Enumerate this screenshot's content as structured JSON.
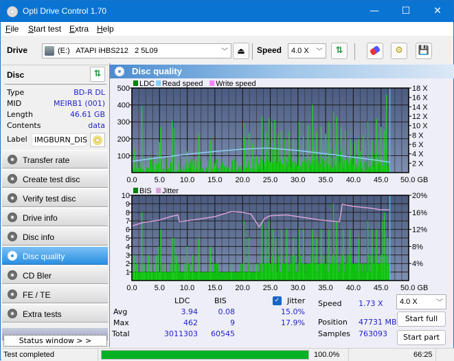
{
  "window": {
    "title": "Opti Drive Control 1.70",
    "minimize": "—",
    "maximize": "☐",
    "close": "✕"
  },
  "menu": {
    "items": [
      {
        "label": "File",
        "accel": "F",
        "rest": "ile"
      },
      {
        "label": "Start test",
        "accel": "S",
        "rest": "tart test"
      },
      {
        "label": "Extra",
        "accel": "E",
        "rest": "xtra"
      },
      {
        "label": "Help",
        "accel": "H",
        "rest": "elp"
      }
    ]
  },
  "toolbar": {
    "drive_label": "Drive",
    "drive_value": "(E:)   ATAPI iHBS212   2 5L09",
    "speed_label": "Speed",
    "speed_value": "4.0 X",
    "icons": [
      "drive-icon",
      "eject-icon",
      "refresh-icon",
      "erase-icon",
      "settings-icon",
      "save-icon"
    ]
  },
  "disc": {
    "header": "Disc",
    "rows": [
      {
        "label": "Type",
        "value": "BD-R DL"
      },
      {
        "label": "MID",
        "value": "MEIRB1 (001)"
      },
      {
        "label": "Length",
        "value": "46.61 GB"
      },
      {
        "label": "Contents",
        "value": "data"
      }
    ],
    "label_label": "Label",
    "label_value": "IMGBURN_DIS"
  },
  "nav": {
    "items": [
      {
        "label": "Transfer rate",
        "active": false
      },
      {
        "label": "Create test disc",
        "active": false
      },
      {
        "label": "Verify test disc",
        "active": false
      },
      {
        "label": "Drive info",
        "active": false
      },
      {
        "label": "Disc info",
        "active": false
      },
      {
        "label": "Disc quality",
        "active": true
      },
      {
        "label": "CD Bler",
        "active": false
      },
      {
        "label": "FE / TE",
        "active": false
      },
      {
        "label": "Extra tests",
        "active": false
      }
    ],
    "status_window": "Status window > >"
  },
  "panel": {
    "title": "Disc quality"
  },
  "chart_data": [
    {
      "type": "bar",
      "title": "",
      "legend": [
        "LDC",
        "Read speed",
        "Write speed"
      ],
      "legend_colors": {
        "LDC": "#008000",
        "Read speed": "#7fcfff",
        "Write speed": "#ff80ff"
      },
      "legend_placement": "top-left",
      "xlabel": "GB",
      "x_ticks": [
        "0.0",
        "5.0",
        "10.0",
        "15.0",
        "20.0",
        "25.0",
        "30.0",
        "35.0",
        "40.0",
        "45.0",
        "50.0 GB"
      ],
      "xlim": [
        0,
        50
      ],
      "y_ticks_left": [
        "500",
        "400",
        "300",
        "200",
        "100"
      ],
      "ylim_left": [
        0,
        500
      ],
      "y_ticks_right": [
        "18 X",
        "16 X",
        "14 X",
        "12 X",
        "10 X",
        "8 X",
        "6 X",
        "4 X",
        "2 X"
      ],
      "ylim_right": [
        0,
        18
      ],
      "end_marker_gb": 46.61,
      "ldc_peaks": [
        {
          "x": 0.5,
          "y": 140
        },
        {
          "x": 1.2,
          "y": 30
        },
        {
          "x": 1.8,
          "y": 395
        },
        {
          "x": 2.5,
          "y": 40
        },
        {
          "x": 3.2,
          "y": 95
        },
        {
          "x": 4.0,
          "y": 60
        },
        {
          "x": 4.6,
          "y": 120
        },
        {
          "x": 5.2,
          "y": 270
        },
        {
          "x": 5.0,
          "y": 180
        },
        {
          "x": 6.0,
          "y": 30
        },
        {
          "x": 7.3,
          "y": 305
        },
        {
          "x": 7.6,
          "y": 265
        },
        {
          "x": 8.5,
          "y": 60
        },
        {
          "x": 10.0,
          "y": 125
        },
        {
          "x": 11.0,
          "y": 50
        },
        {
          "x": 12.1,
          "y": 235
        },
        {
          "x": 14.2,
          "y": 190
        },
        {
          "x": 15.0,
          "y": 40
        },
        {
          "x": 17.0,
          "y": 30
        },
        {
          "x": 18.5,
          "y": 35
        },
        {
          "x": 20.2,
          "y": 295
        },
        {
          "x": 20.4,
          "y": 200
        },
        {
          "x": 21.2,
          "y": 235
        },
        {
          "x": 21.8,
          "y": 175
        },
        {
          "x": 22.5,
          "y": 100
        },
        {
          "x": 23.5,
          "y": 330
        },
        {
          "x": 24.2,
          "y": 240
        },
        {
          "x": 24.8,
          "y": 320
        },
        {
          "x": 25.2,
          "y": 300
        },
        {
          "x": 25.8,
          "y": 310
        },
        {
          "x": 26.4,
          "y": 230
        },
        {
          "x": 27.0,
          "y": 250
        },
        {
          "x": 27.6,
          "y": 200
        },
        {
          "x": 28.4,
          "y": 240
        },
        {
          "x": 29.2,
          "y": 200
        },
        {
          "x": 30.2,
          "y": 300
        },
        {
          "x": 31.0,
          "y": 220
        },
        {
          "x": 31.8,
          "y": 280
        },
        {
          "x": 32.6,
          "y": 400
        },
        {
          "x": 33.4,
          "y": 240
        },
        {
          "x": 34.2,
          "y": 270
        },
        {
          "x": 35.0,
          "y": 230
        },
        {
          "x": 35.6,
          "y": 300
        },
        {
          "x": 36.4,
          "y": 360
        },
        {
          "x": 37.0,
          "y": 330
        },
        {
          "x": 37.8,
          "y": 270
        },
        {
          "x": 38.6,
          "y": 250
        },
        {
          "x": 39.4,
          "y": 200
        },
        {
          "x": 40.2,
          "y": 180
        },
        {
          "x": 41.0,
          "y": 200
        },
        {
          "x": 41.8,
          "y": 220
        },
        {
          "x": 42.6,
          "y": 300
        },
        {
          "x": 43.4,
          "y": 190
        },
        {
          "x": 44.2,
          "y": 320
        },
        {
          "x": 45.0,
          "y": 270
        },
        {
          "x": 45.6,
          "y": 250
        },
        {
          "x": 46.0,
          "y": 462
        }
      ],
      "read_speed": [
        {
          "x": 0,
          "y": 2.4
        },
        {
          "x": 5,
          "y": 3.2
        },
        {
          "x": 10,
          "y": 3.9
        },
        {
          "x": 15,
          "y": 4.5
        },
        {
          "x": 20,
          "y": 5.0
        },
        {
          "x": 23.5,
          "y": 5.2
        },
        {
          "x": 25,
          "y": 5.2
        },
        {
          "x": 30,
          "y": 4.7
        },
        {
          "x": 35,
          "y": 4.0
        },
        {
          "x": 40,
          "y": 3.3
        },
        {
          "x": 45,
          "y": 2.5
        },
        {
          "x": 46.6,
          "y": 2.2
        }
      ]
    },
    {
      "type": "bar",
      "title": "",
      "legend": [
        "BIS",
        "Jitter"
      ],
      "legend_colors": {
        "BIS": "#008000",
        "Jitter": "#d8a0d8"
      },
      "legend_placement": "top-left",
      "xlabel": "GB",
      "x_ticks": [
        "0.0",
        "5.0",
        "10.0",
        "15.0",
        "20.0",
        "25.0",
        "30.0",
        "35.0",
        "40.0",
        "45.0",
        "50.0 GB"
      ],
      "xlim": [
        0,
        50
      ],
      "y_ticks_left": [
        "10",
        "9",
        "8",
        "7",
        "6",
        "5",
        "4",
        "3",
        "2",
        "1"
      ],
      "ylim_left": [
        0,
        10
      ],
      "y_ticks_right": [
        "20%",
        "16%",
        "12%",
        "8%",
        "4%"
      ],
      "ylim_right": [
        0,
        20
      ],
      "end_marker_gb": 46.61,
      "bis_peaks": [
        {
          "x": 0.4,
          "y": 3
        },
        {
          "x": 0.9,
          "y": 2
        },
        {
          "x": 1.8,
          "y": 8
        },
        {
          "x": 2.2,
          "y": 2
        },
        {
          "x": 3.0,
          "y": 3
        },
        {
          "x": 3.6,
          "y": 2
        },
        {
          "x": 4.4,
          "y": 3
        },
        {
          "x": 4.9,
          "y": 4
        },
        {
          "x": 5.2,
          "y": 6
        },
        {
          "x": 6.0,
          "y": 2
        },
        {
          "x": 7.3,
          "y": 5
        },
        {
          "x": 7.6,
          "y": 5
        },
        {
          "x": 8.0,
          "y": 3
        },
        {
          "x": 9.6,
          "y": 2
        },
        {
          "x": 10.0,
          "y": 4
        },
        {
          "x": 11.0,
          "y": 3
        },
        {
          "x": 12.1,
          "y": 5
        },
        {
          "x": 14.2,
          "y": 4
        },
        {
          "x": 18.0,
          "y": 2
        },
        {
          "x": 20.2,
          "y": 7
        },
        {
          "x": 21.2,
          "y": 5
        },
        {
          "x": 22.5,
          "y": 2
        },
        {
          "x": 23.5,
          "y": 7
        },
        {
          "x": 24.2,
          "y": 6
        },
        {
          "x": 24.8,
          "y": 7
        },
        {
          "x": 25.5,
          "y": 6
        },
        {
          "x": 26.0,
          "y": 5
        },
        {
          "x": 27.0,
          "y": 6
        },
        {
          "x": 28.0,
          "y": 6
        },
        {
          "x": 29.2,
          "y": 5
        },
        {
          "x": 30.2,
          "y": 6
        },
        {
          "x": 31.0,
          "y": 6
        },
        {
          "x": 32.6,
          "y": 6
        },
        {
          "x": 33.4,
          "y": 5
        },
        {
          "x": 34.2,
          "y": 6
        },
        {
          "x": 35.6,
          "y": 6
        },
        {
          "x": 36.4,
          "y": 9
        },
        {
          "x": 37.0,
          "y": 7
        },
        {
          "x": 38.2,
          "y": 6
        },
        {
          "x": 39.4,
          "y": 6
        },
        {
          "x": 41.0,
          "y": 5
        },
        {
          "x": 42.6,
          "y": 7
        },
        {
          "x": 43.4,
          "y": 6
        },
        {
          "x": 44.2,
          "y": 6
        },
        {
          "x": 45.2,
          "y": 7
        },
        {
          "x": 45.6,
          "y": 8
        },
        {
          "x": 46.2,
          "y": 5
        }
      ],
      "jitter": [
        {
          "x": 0,
          "y": 12.8
        },
        {
          "x": 2,
          "y": 13.6
        },
        {
          "x": 5,
          "y": 14.2
        },
        {
          "x": 7,
          "y": 15.0
        },
        {
          "x": 8.3,
          "y": 15.4
        },
        {
          "x": 8.6,
          "y": 13.8
        },
        {
          "x": 12,
          "y": 14.4
        },
        {
          "x": 15,
          "y": 15.0
        },
        {
          "x": 18,
          "y": 16.2
        },
        {
          "x": 20,
          "y": 16.0
        },
        {
          "x": 21.5,
          "y": 15.6
        },
        {
          "x": 23,
          "y": 12.6
        },
        {
          "x": 24,
          "y": 14.6
        },
        {
          "x": 25,
          "y": 15.2
        },
        {
          "x": 28,
          "y": 15.4
        },
        {
          "x": 31,
          "y": 14.8
        },
        {
          "x": 34,
          "y": 14.2
        },
        {
          "x": 37.5,
          "y": 13.8
        },
        {
          "x": 38.0,
          "y": 17.9
        },
        {
          "x": 40,
          "y": 17.4
        },
        {
          "x": 43,
          "y": 17.0
        },
        {
          "x": 45,
          "y": 16.6
        },
        {
          "x": 46.5,
          "y": 16.6
        }
      ]
    }
  ],
  "stats": {
    "headers": {
      "ldc": "LDC",
      "bis": "BIS",
      "jitter": "Jitter"
    },
    "jitter_checked": true,
    "rows": [
      {
        "label": "Avg",
        "ldc": "3.94",
        "bis": "0.08",
        "jitter": "15.0%"
      },
      {
        "label": "Max",
        "ldc": "462",
        "bis": "9",
        "jitter": "17.9%"
      },
      {
        "label": "Total",
        "ldc": "3011303",
        "bis": "60545",
        "jitter": ""
      }
    ],
    "speed_label": "Speed",
    "speed_value": "1.73 X",
    "position_label": "Position",
    "position_value": "47731 MB",
    "samples_label": "Samples",
    "samples_value": "763093",
    "speed_select": "4.0 X",
    "start_full": "Start full",
    "start_part": "Start part"
  },
  "statusbar": {
    "text": "Test completed",
    "progress": 100.0,
    "progress_text": "100.0%",
    "time": "66:25"
  }
}
